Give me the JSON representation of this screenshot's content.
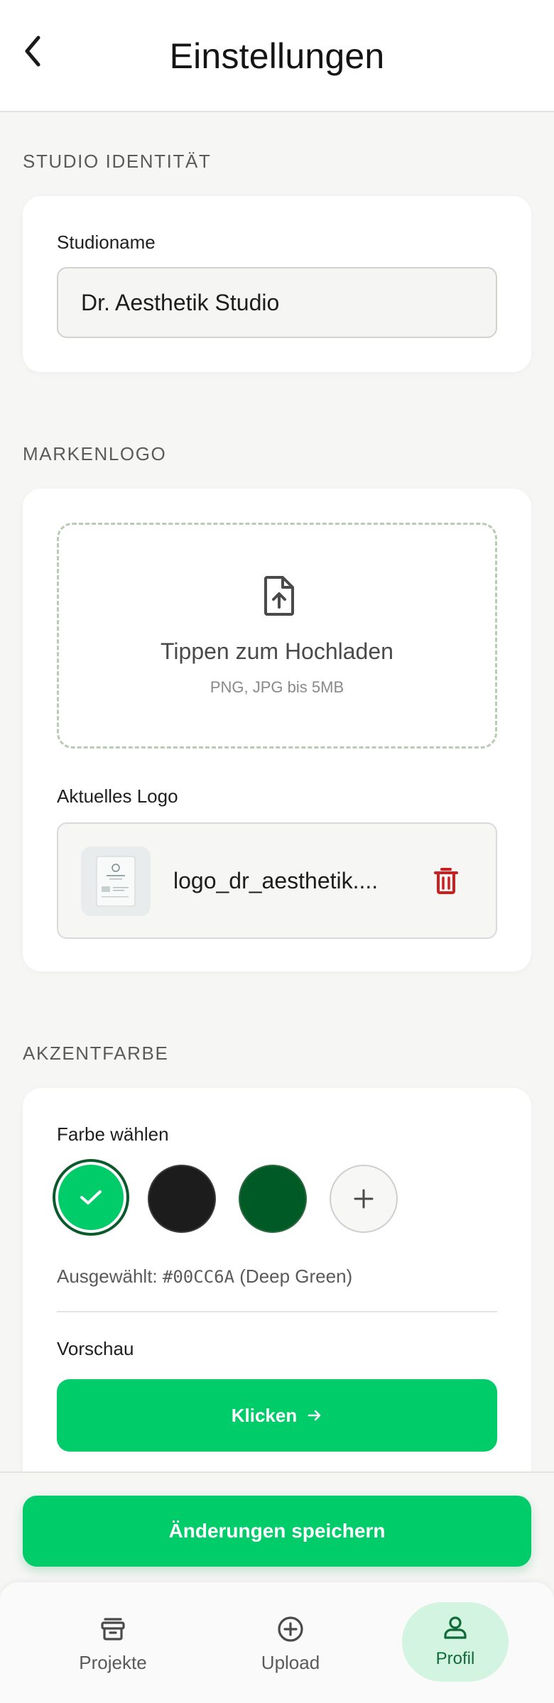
{
  "header": {
    "title": "Einstellungen"
  },
  "studio_identity": {
    "section_label": "STUDIO IDENTITÄT",
    "name_label": "Studioname",
    "name_value": "Dr. Aesthetik Studio"
  },
  "brand_logo": {
    "section_label": "MARKENLOGO",
    "upload_title": "Tippen zum Hochladen",
    "upload_hint": "PNG, JPG bis 5MB",
    "current_label": "Aktuelles Logo",
    "current_filename": "logo_dr_aesthetik...."
  },
  "accent_color": {
    "section_label": "AKZENTFARBE",
    "choose_label": "Farbe wählen",
    "swatches": [
      "#00CC6A",
      "#1C1C1C",
      "#005A25"
    ],
    "selected_prefix": "Ausgewählt: ",
    "selected_hex": "#00CC6A",
    "selected_name": " (Deep Green)",
    "preview_label": "Vorschau",
    "preview_button": "Klicken"
  },
  "save_button": "Änderungen speichern",
  "nav": {
    "items": [
      {
        "label": "Projekte",
        "icon": "archive-icon"
      },
      {
        "label": "Upload",
        "icon": "plus-circle-icon"
      },
      {
        "label": "Profil",
        "icon": "user-icon"
      }
    ],
    "active": "Profil"
  }
}
